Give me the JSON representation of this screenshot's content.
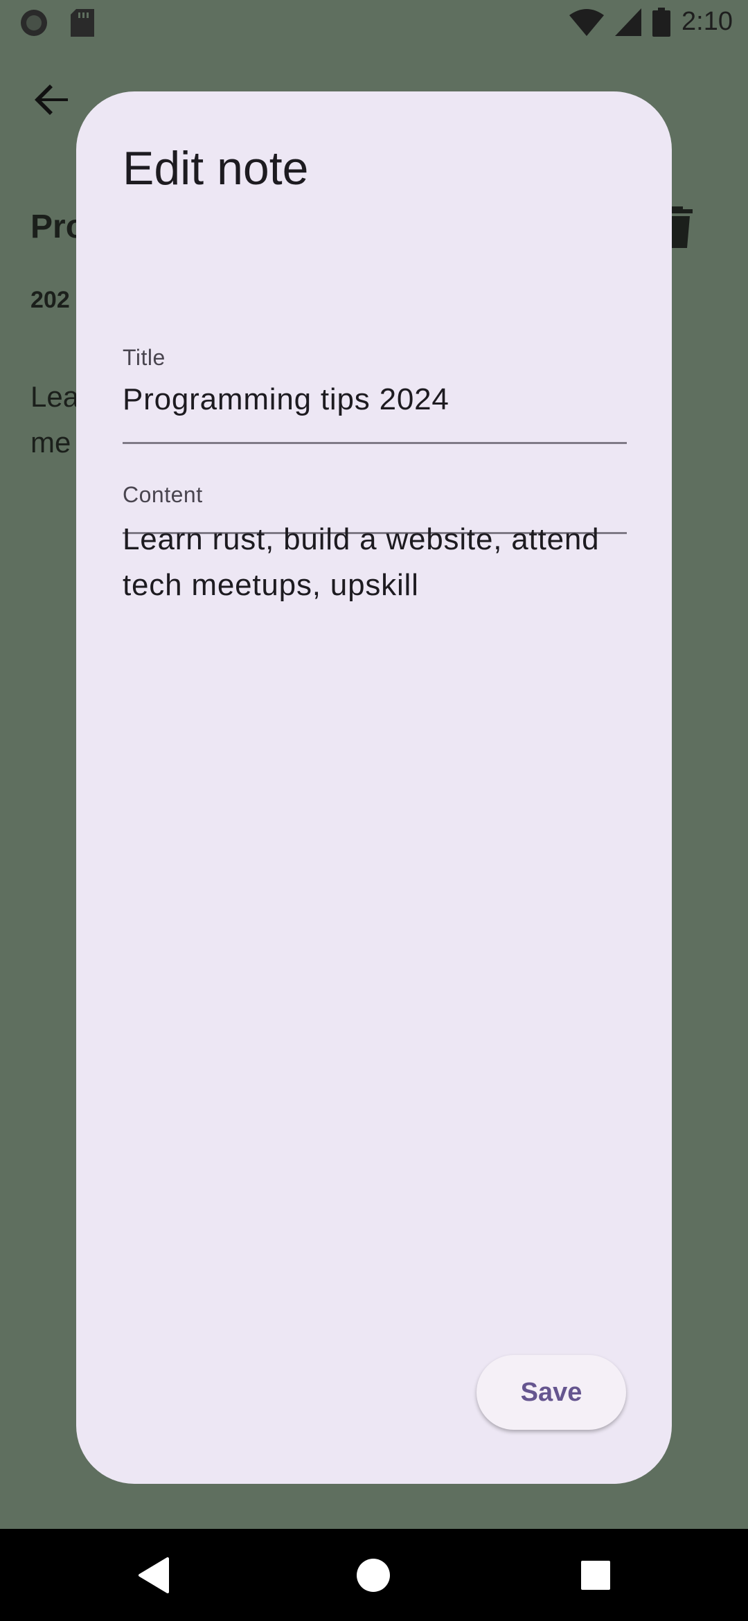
{
  "status_bar": {
    "time": "2:10",
    "left_icons": [
      "notification-circle-icon",
      "sd-card-icon"
    ],
    "right_icons": [
      "wifi-icon",
      "cell-signal-icon",
      "battery-icon"
    ]
  },
  "background": {
    "title_fragment": "Pro",
    "date_fragment": "202",
    "content_line1": "Lea",
    "content_line2": "me"
  },
  "dialog": {
    "title": "Edit note",
    "title_field": {
      "label": "Title",
      "value": "Programming tips 2024"
    },
    "content_field": {
      "label": "Content",
      "value": "Learn rust, build a website, attend tech meetups, upskill"
    },
    "save_label": "Save"
  },
  "colors": {
    "scrim_background": "#5f6f5f",
    "dialog_surface": "#ede7f4",
    "primary": "#65558f",
    "on_surface": "#1d1b20",
    "outline": "#7f7a86"
  }
}
